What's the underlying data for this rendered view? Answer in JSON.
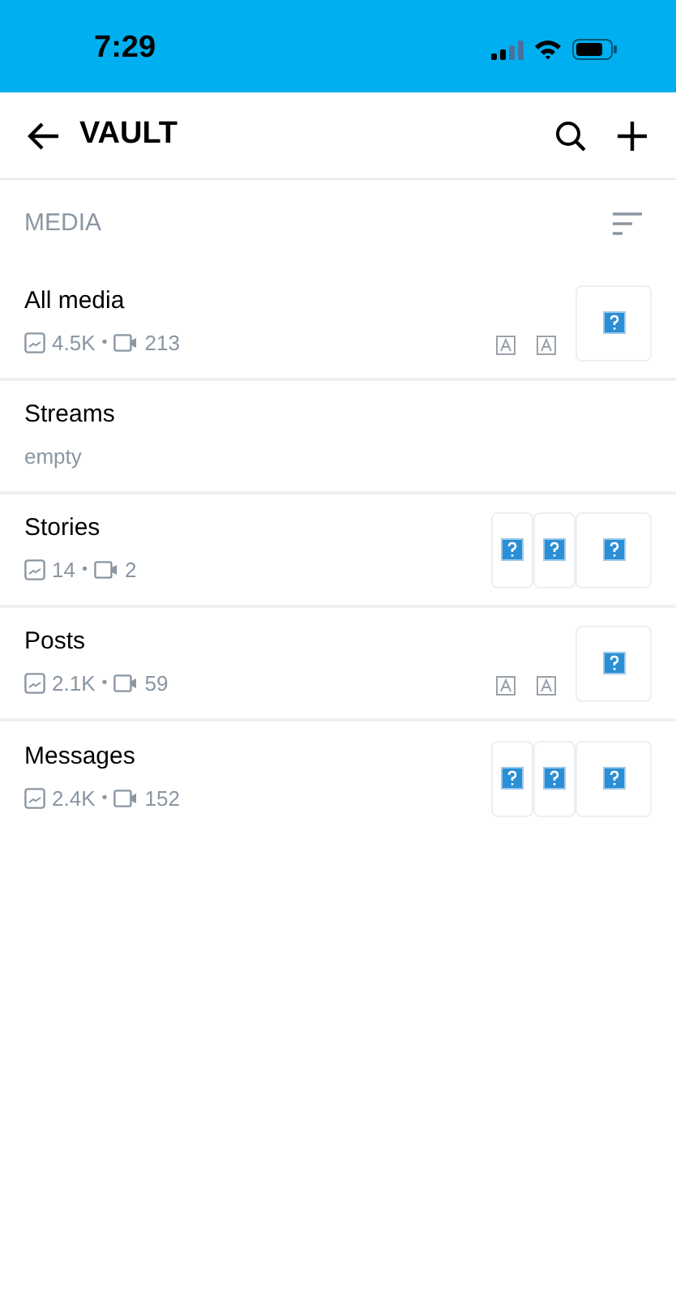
{
  "status_bar": {
    "time": "7:29"
  },
  "header": {
    "title": "VAULT"
  },
  "section": {
    "title": "MEDIA"
  },
  "lists": [
    {
      "title": "All media",
      "kind": "counts",
      "photos": "4.5K",
      "separator": "•",
      "videos": "213",
      "preview": {
        "kind": "single"
      }
    },
    {
      "title": "Streams",
      "kind": "empty",
      "subtitle": "empty"
    },
    {
      "title": "Stories",
      "kind": "counts",
      "photos": "14",
      "separator": "•",
      "videos": "2",
      "preview": {
        "kind": "stack"
      }
    },
    {
      "title": "Posts",
      "kind": "counts",
      "photos": "2.1K",
      "separator": "•",
      "videos": "59",
      "preview": {
        "kind": "single"
      }
    },
    {
      "title": "Messages",
      "kind": "counts",
      "photos": "2.4K",
      "separator": "•",
      "videos": "152",
      "preview": {
        "kind": "stack"
      }
    }
  ]
}
